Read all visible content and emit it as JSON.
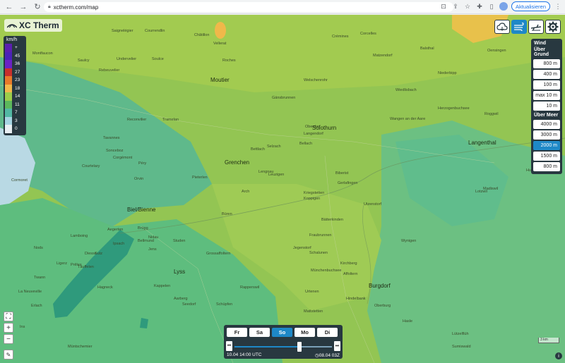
{
  "browser": {
    "url": "xctherm.com/map",
    "update_label": "Aktualisieren"
  },
  "app": {
    "name": "XC Therm"
  },
  "legend": {
    "unit": "km/h",
    "items": [
      {
        "label": "+",
        "color": "#5b1fb0"
      },
      {
        "label": "45",
        "color": "#4a22b8"
      },
      {
        "label": "36",
        "color": "#6a22c4"
      },
      {
        "label": "27",
        "color": "#c8302c"
      },
      {
        "label": "23",
        "color": "#e87a2a"
      },
      {
        "label": "18",
        "color": "#f2b84a"
      },
      {
        "label": "14",
        "color": "#9ccc4a"
      },
      {
        "label": "11",
        "color": "#5cb85c"
      },
      {
        "label": "7",
        "color": "#52b8a4"
      },
      {
        "label": "3",
        "color": "#a6d4e2"
      },
      {
        "label": "0",
        "color": "#e8eef2"
      }
    ]
  },
  "tools": [
    {
      "name": "weather-cloud-icon"
    },
    {
      "name": "wind-icon"
    },
    {
      "name": "glider-icon"
    },
    {
      "name": "gear-icon"
    }
  ],
  "wind_panel": {
    "title": "Wind",
    "ground_header": "Über Grund",
    "ground_levels": [
      "800 m",
      "400 m",
      "100 m",
      "max 10 m",
      "10 m"
    ],
    "sea_header": "Über Meer",
    "sea_levels": [
      "4000 m",
      "3000 m",
      "2000 m",
      "1500 m",
      "800 m"
    ],
    "active_level": "2000 m"
  },
  "time_control": {
    "days": [
      "Fr",
      "Sa",
      "So",
      "Mo",
      "Di"
    ],
    "active_day": "So",
    "current_time": "10.04 14:00 UTC",
    "model_run": "08.04 03Z",
    "progress": 0.67
  },
  "map": {
    "scale_label": "3 km",
    "cities": [
      {
        "name": "Moutier"
      },
      {
        "name": "Grenchen"
      },
      {
        "name": "Solothurn"
      },
      {
        "name": "Biel/Bienne"
      },
      {
        "name": "Lyss"
      },
      {
        "name": "Burgdorf"
      },
      {
        "name": "Langenthal"
      }
    ],
    "places": [
      "Saignelégier",
      "Courrendlin",
      "Vellerat",
      "Châtillon",
      "Montfaucon",
      "Saulcy",
      "Rebeuvelier",
      "Undervelier",
      "Soulce",
      "Roches",
      "Crémines",
      "Corcelles",
      "Welschenrohr",
      "Gänsbrunnen",
      "Matzendorf",
      "Balsthal",
      "Oensingen",
      "Niederbipp",
      "Wiedlisbach",
      "Wangen an der Aare",
      "Herzogenbuchsee",
      "Bettlach",
      "Selzach",
      "Bellach",
      "Langendorf",
      "Oberdorf",
      "Lengnau",
      "Pieterlen",
      "Büren",
      "Leuzigen",
      "Arch",
      "Biberist",
      "Gerlafingen",
      "Kriegstetten",
      "Utzenstorf",
      "Bätterkinden",
      "Fraubrunnen",
      "Jegenstorf",
      "Schalunen",
      "Kirchberg",
      "Koppigen",
      "Wynigen",
      "Affoltern",
      "Lotzwil",
      "Madiswil",
      "Roggwil",
      "Murgenthal",
      "Nidau",
      "Brügg",
      "Aegerten",
      "Studen",
      "Jens",
      "Bellmund",
      "Ipsach",
      "Sutz",
      "Täuffelen",
      "Hagneck",
      "Aarberg",
      "Kappelen",
      "Seedorf",
      "Schüpfen",
      "Grossaffoltern",
      "Rapperswil",
      "Münchenbuchsee",
      "Urtenen",
      "Mattstetten",
      "Hindelbank",
      "Oberburg",
      "Hasle",
      "Lützelflüh",
      "Sumiswald",
      "Huttwil",
      "Tavannes",
      "Reconvilier",
      "Tramelan",
      "Péry",
      "Orvin",
      "Lamboing",
      "Diesse",
      "Prêles",
      "Ligerz",
      "Twann",
      "Erlach",
      "Ins",
      "Müntschemier",
      "La Neuveville",
      "Nods",
      "Cormoret",
      "Courtelary",
      "Sonceboz",
      "Corgémont"
    ]
  }
}
